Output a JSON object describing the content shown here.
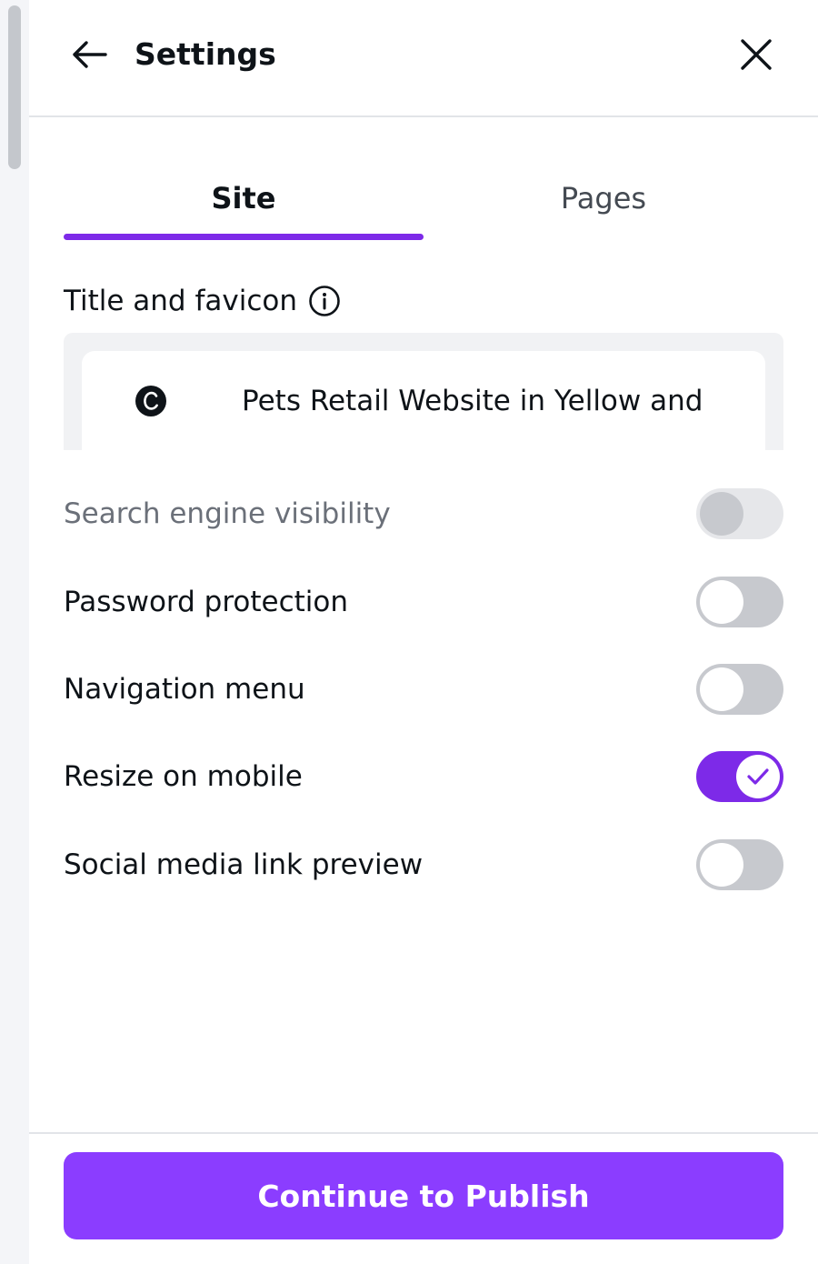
{
  "header": {
    "title": "Settings"
  },
  "tabs": [
    {
      "label": "Site",
      "active": true
    },
    {
      "label": "Pages",
      "active": false
    }
  ],
  "title_section": {
    "label": "Title and favicon",
    "site_title_value": "Pets Retail Website in Yellow and"
  },
  "settings": [
    {
      "label": "Search engine visibility",
      "state": "disabled"
    },
    {
      "label": "Password protection",
      "state": "off"
    },
    {
      "label": "Navigation menu",
      "state": "off"
    },
    {
      "label": "Resize on mobile",
      "state": "on"
    },
    {
      "label": "Social media link preview",
      "state": "off"
    }
  ],
  "footer": {
    "publish_label": "Continue to Publish"
  },
  "colors": {
    "accent": "#7d2ae8",
    "button": "#8b3dff",
    "toggle_off": "#c7c9ce"
  },
  "icons": {
    "back": "arrow-left-icon",
    "close": "close-icon",
    "info": "info-icon",
    "favicon": "canva-logo-icon",
    "check": "check-icon"
  }
}
